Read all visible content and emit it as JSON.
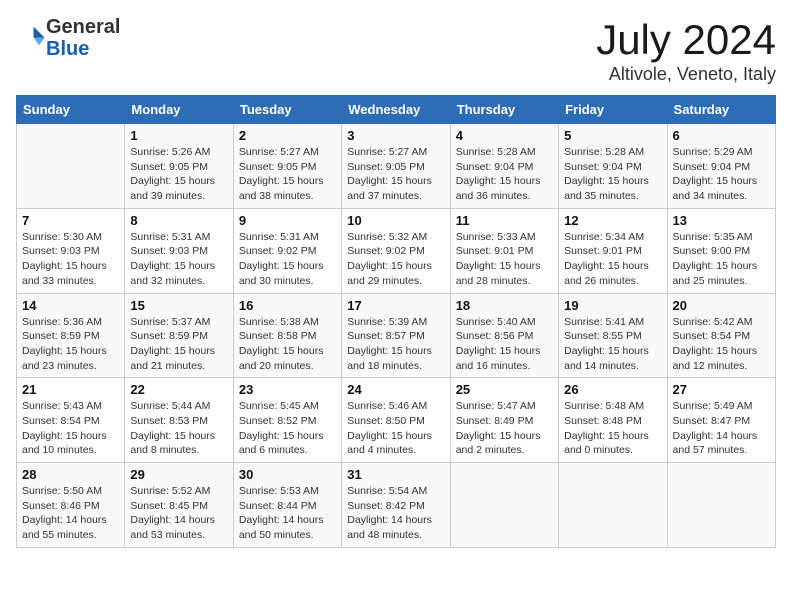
{
  "header": {
    "logo_general": "General",
    "logo_blue": "Blue",
    "month": "July 2024",
    "location": "Altivole, Veneto, Italy"
  },
  "days_of_week": [
    "Sunday",
    "Monday",
    "Tuesday",
    "Wednesday",
    "Thursday",
    "Friday",
    "Saturday"
  ],
  "weeks": [
    [
      null,
      {
        "day": 1,
        "sunrise": "5:26 AM",
        "sunset": "9:05 PM",
        "daylight": "15 hours and 39 minutes."
      },
      {
        "day": 2,
        "sunrise": "5:27 AM",
        "sunset": "9:05 PM",
        "daylight": "15 hours and 38 minutes."
      },
      {
        "day": 3,
        "sunrise": "5:27 AM",
        "sunset": "9:05 PM",
        "daylight": "15 hours and 37 minutes."
      },
      {
        "day": 4,
        "sunrise": "5:28 AM",
        "sunset": "9:04 PM",
        "daylight": "15 hours and 36 minutes."
      },
      {
        "day": 5,
        "sunrise": "5:28 AM",
        "sunset": "9:04 PM",
        "daylight": "15 hours and 35 minutes."
      },
      {
        "day": 6,
        "sunrise": "5:29 AM",
        "sunset": "9:04 PM",
        "daylight": "15 hours and 34 minutes."
      }
    ],
    [
      {
        "day": 7,
        "sunrise": "5:30 AM",
        "sunset": "9:03 PM",
        "daylight": "15 hours and 33 minutes."
      },
      {
        "day": 8,
        "sunrise": "5:31 AM",
        "sunset": "9:03 PM",
        "daylight": "15 hours and 32 minutes."
      },
      {
        "day": 9,
        "sunrise": "5:31 AM",
        "sunset": "9:02 PM",
        "daylight": "15 hours and 30 minutes."
      },
      {
        "day": 10,
        "sunrise": "5:32 AM",
        "sunset": "9:02 PM",
        "daylight": "15 hours and 29 minutes."
      },
      {
        "day": 11,
        "sunrise": "5:33 AM",
        "sunset": "9:01 PM",
        "daylight": "15 hours and 28 minutes."
      },
      {
        "day": 12,
        "sunrise": "5:34 AM",
        "sunset": "9:01 PM",
        "daylight": "15 hours and 26 minutes."
      },
      {
        "day": 13,
        "sunrise": "5:35 AM",
        "sunset": "9:00 PM",
        "daylight": "15 hours and 25 minutes."
      }
    ],
    [
      {
        "day": 14,
        "sunrise": "5:36 AM",
        "sunset": "8:59 PM",
        "daylight": "15 hours and 23 minutes."
      },
      {
        "day": 15,
        "sunrise": "5:37 AM",
        "sunset": "8:59 PM",
        "daylight": "15 hours and 21 minutes."
      },
      {
        "day": 16,
        "sunrise": "5:38 AM",
        "sunset": "8:58 PM",
        "daylight": "15 hours and 20 minutes."
      },
      {
        "day": 17,
        "sunrise": "5:39 AM",
        "sunset": "8:57 PM",
        "daylight": "15 hours and 18 minutes."
      },
      {
        "day": 18,
        "sunrise": "5:40 AM",
        "sunset": "8:56 PM",
        "daylight": "15 hours and 16 minutes."
      },
      {
        "day": 19,
        "sunrise": "5:41 AM",
        "sunset": "8:55 PM",
        "daylight": "15 hours and 14 minutes."
      },
      {
        "day": 20,
        "sunrise": "5:42 AM",
        "sunset": "8:54 PM",
        "daylight": "15 hours and 12 minutes."
      }
    ],
    [
      {
        "day": 21,
        "sunrise": "5:43 AM",
        "sunset": "8:54 PM",
        "daylight": "15 hours and 10 minutes."
      },
      {
        "day": 22,
        "sunrise": "5:44 AM",
        "sunset": "8:53 PM",
        "daylight": "15 hours and 8 minutes."
      },
      {
        "day": 23,
        "sunrise": "5:45 AM",
        "sunset": "8:52 PM",
        "daylight": "15 hours and 6 minutes."
      },
      {
        "day": 24,
        "sunrise": "5:46 AM",
        "sunset": "8:50 PM",
        "daylight": "15 hours and 4 minutes."
      },
      {
        "day": 25,
        "sunrise": "5:47 AM",
        "sunset": "8:49 PM",
        "daylight": "15 hours and 2 minutes."
      },
      {
        "day": 26,
        "sunrise": "5:48 AM",
        "sunset": "8:48 PM",
        "daylight": "15 hours and 0 minutes."
      },
      {
        "day": 27,
        "sunrise": "5:49 AM",
        "sunset": "8:47 PM",
        "daylight": "14 hours and 57 minutes."
      }
    ],
    [
      {
        "day": 28,
        "sunrise": "5:50 AM",
        "sunset": "8:46 PM",
        "daylight": "14 hours and 55 minutes."
      },
      {
        "day": 29,
        "sunrise": "5:52 AM",
        "sunset": "8:45 PM",
        "daylight": "14 hours and 53 minutes."
      },
      {
        "day": 30,
        "sunrise": "5:53 AM",
        "sunset": "8:44 PM",
        "daylight": "14 hours and 50 minutes."
      },
      {
        "day": 31,
        "sunrise": "5:54 AM",
        "sunset": "8:42 PM",
        "daylight": "14 hours and 48 minutes."
      },
      null,
      null,
      null
    ]
  ]
}
